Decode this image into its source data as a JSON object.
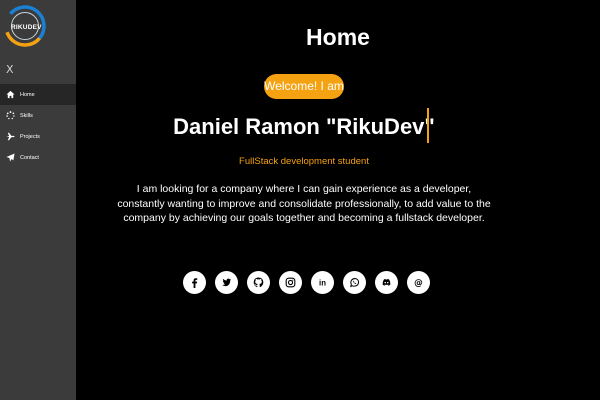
{
  "sidebar": {
    "logo_text": "RIKUDEV",
    "close_label": "X",
    "items": [
      {
        "label": "Home",
        "icon": "home-icon"
      },
      {
        "label": "Skills",
        "icon": "spinner-icon"
      },
      {
        "label": "Projects",
        "icon": "plane-icon"
      },
      {
        "label": "Contact",
        "icon": "paper-plane-icon"
      }
    ]
  },
  "main": {
    "title": "Home",
    "welcome": "Welcome! I am",
    "name": "Daniel Ramon \"RikuDev\"",
    "subtitle": "FullStack development student",
    "about": "I am looking for a company where I can gain experience as a developer, constantly wanting to improve and consolidate professionally, to add value to the company by achieving our goals together and becoming a fullstack developer.",
    "socials": [
      {
        "icon": "facebook-icon"
      },
      {
        "icon": "twitter-icon"
      },
      {
        "icon": "github-icon"
      },
      {
        "icon": "instagram-icon"
      },
      {
        "icon": "linkedin-icon",
        "label": "in"
      },
      {
        "icon": "whatsapp-icon"
      },
      {
        "icon": "discord-icon"
      },
      {
        "icon": "email-icon",
        "label": "@"
      }
    ]
  },
  "colors": {
    "accent": "#f5a212",
    "sidebar_bg": "#3b3b3b",
    "active_bg": "#262626",
    "page_bg": "#000000"
  }
}
